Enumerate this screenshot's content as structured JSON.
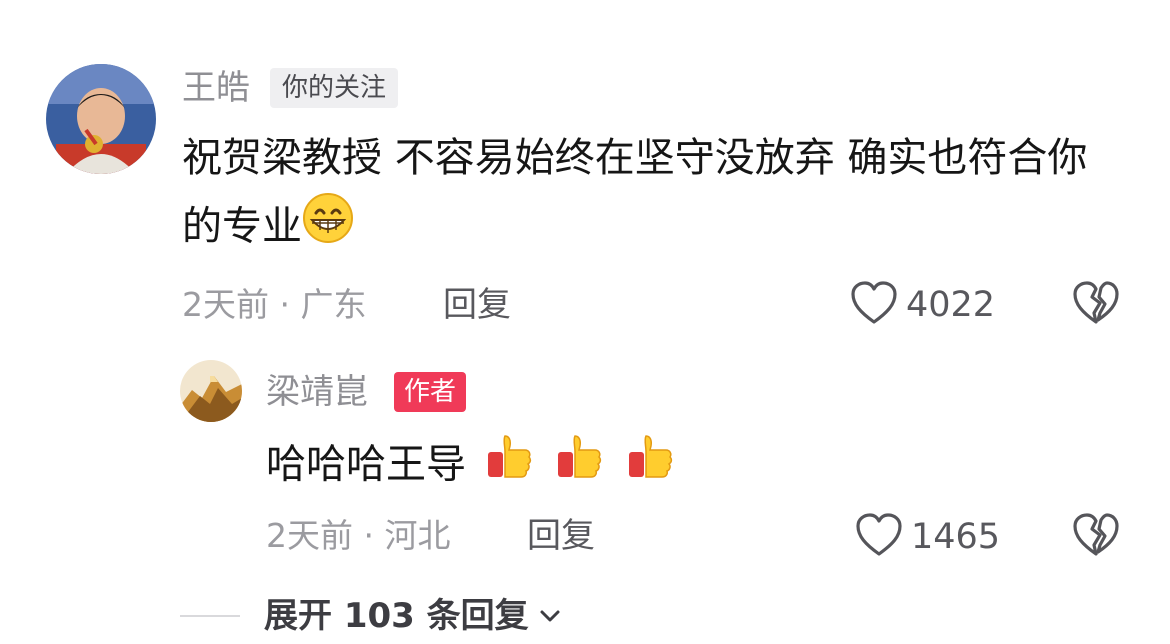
{
  "comment": {
    "username": "王皓",
    "tag": "你的关注",
    "text": "祝贺梁教授 不容易始终在坚守没放弃 确实也符合你的专业",
    "emoji": "grinning-face-emoji",
    "meta": "2天前 · 广东",
    "reply_label": "回复",
    "like_count": "4022"
  },
  "reply": {
    "username": "梁靖崑",
    "tag": "作者",
    "text": "哈哈哈王导",
    "emoji": "thumbs-up-emoji",
    "meta": "2天前 · 河北",
    "reply_label": "回复",
    "like_count": "1465"
  },
  "expand": {
    "label": "展开 103 条回复"
  },
  "colors": {
    "author_tag": "#f03a58",
    "follow_tag_bg": "#efeff1",
    "username": "#8f8f94",
    "text": "#161616"
  }
}
